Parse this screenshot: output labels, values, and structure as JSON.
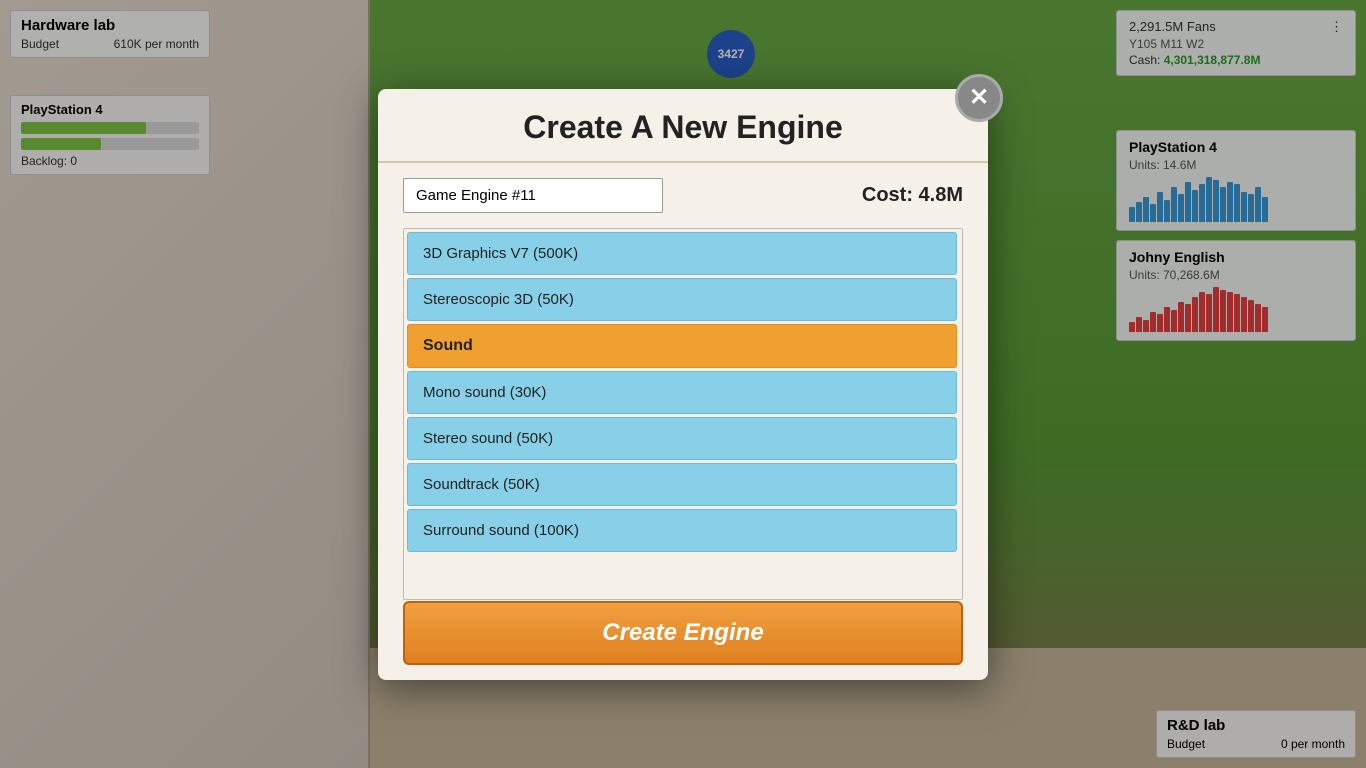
{
  "game": {
    "badge_count": "3427"
  },
  "hud": {
    "hardware_lab": {
      "title": "Hardware lab",
      "budget_label": "Budget",
      "budget_value": "610K per month"
    },
    "ps4_left": {
      "title": "PlayStation 4",
      "backlog": "Backlog: 0"
    },
    "top_right": {
      "fans": "2,291.5M Fans",
      "year": "Y105 M11 W2",
      "cash_label": "Cash:",
      "cash_value": "4,301,318,877.8M"
    },
    "ps4_right": {
      "title": "PlayStation 4",
      "units": "Units: 14.6M"
    },
    "johny": {
      "title": "Johny English",
      "units": "Units: 70,268.6M"
    },
    "rd_lab": {
      "title": "R&D lab",
      "budget_label": "Budget",
      "budget_value": "0 per month"
    }
  },
  "modal": {
    "title": "Create A New Engine",
    "close_label": "✕",
    "engine_name": "Game Engine #11",
    "engine_name_placeholder": "Game Engine #11",
    "cost_label": "Cost: 4.8M",
    "features": [
      {
        "type": "item",
        "label": "3D Graphics V7 (500K)"
      },
      {
        "type": "item",
        "label": "Stereoscopic 3D (50K)"
      },
      {
        "type": "category",
        "label": "Sound"
      },
      {
        "type": "item",
        "label": "Mono sound (30K)"
      },
      {
        "type": "item",
        "label": "Stereo sound (50K)"
      },
      {
        "type": "item",
        "label": "Soundtrack (50K)"
      },
      {
        "type": "item",
        "label": "Surround sound (100K)"
      }
    ],
    "create_button": "Create Engine"
  }
}
